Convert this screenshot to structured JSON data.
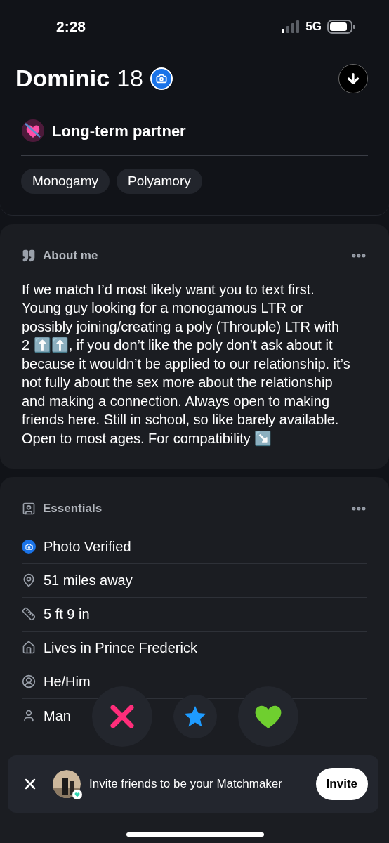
{
  "status_bar": {
    "time": "2:28",
    "network": "5G"
  },
  "profile": {
    "name": "Dominic",
    "age": "18",
    "verified": true,
    "looking_for": "Long-term partner",
    "tags": [
      "Monogamy",
      "Polyamory"
    ]
  },
  "about": {
    "title": "About me",
    "text": "If we match I’d most likely want you to text first. Young guy looking for a monogamous LTR or possibly joining/creating a poly (Throuple) LTR with 2 ⬆️⬆️, if you don’t like the poly don’t ask about it because it wouldn’t be applied to our relationship. it’s not fully about the sex more about the relationship and making a connection. Always open to making friends here. Still in school, so like barely available. Open to most ages. For compatibility ↘️"
  },
  "essentials": {
    "title": "Essentials",
    "items": [
      {
        "kind": "verified",
        "label": "Photo Verified"
      },
      {
        "kind": "distance",
        "label": "51 miles away"
      },
      {
        "kind": "height",
        "label": "5 ft 9 in"
      },
      {
        "kind": "home",
        "label": "Lives in Prince Frederick"
      },
      {
        "kind": "pronouns",
        "label": "He/Him"
      },
      {
        "kind": "gender",
        "label": "Man"
      }
    ]
  },
  "banner": {
    "text": "Invite friends to be your Matchmaker",
    "button": "Invite"
  }
}
